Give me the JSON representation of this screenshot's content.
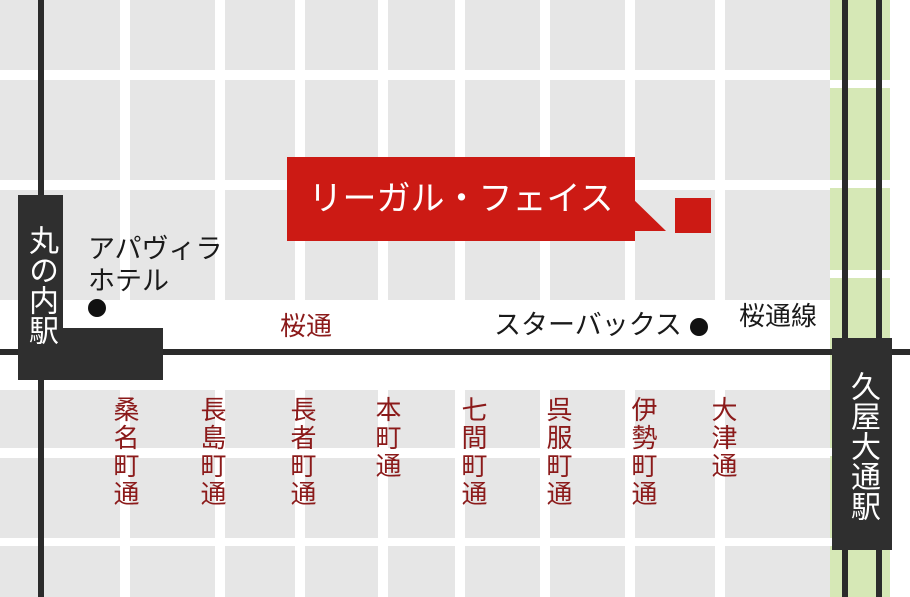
{
  "destination": {
    "name": "リーガル・フェイス"
  },
  "stations": {
    "left": "丸の内駅",
    "right": "久屋大通駅"
  },
  "landmarks": {
    "hotel_line1": "アパヴィラ",
    "hotel_line2": "ホテル",
    "starbucks": "スターバックス"
  },
  "streets": {
    "horizontal": "桜通",
    "rail_line": "桜通線",
    "cross": [
      "桑名町通",
      "長島町通",
      "長者町通",
      "本町通",
      "七間町通",
      "呉服町通",
      "伊勢町通",
      "大津通"
    ]
  },
  "colors": {
    "accent_red": "#cc1a14",
    "street_label": "#8b1a1a",
    "station_bg": "#2f2f2f",
    "park_green": "#d6e8b6",
    "block_grey": "#e6e6e6"
  }
}
